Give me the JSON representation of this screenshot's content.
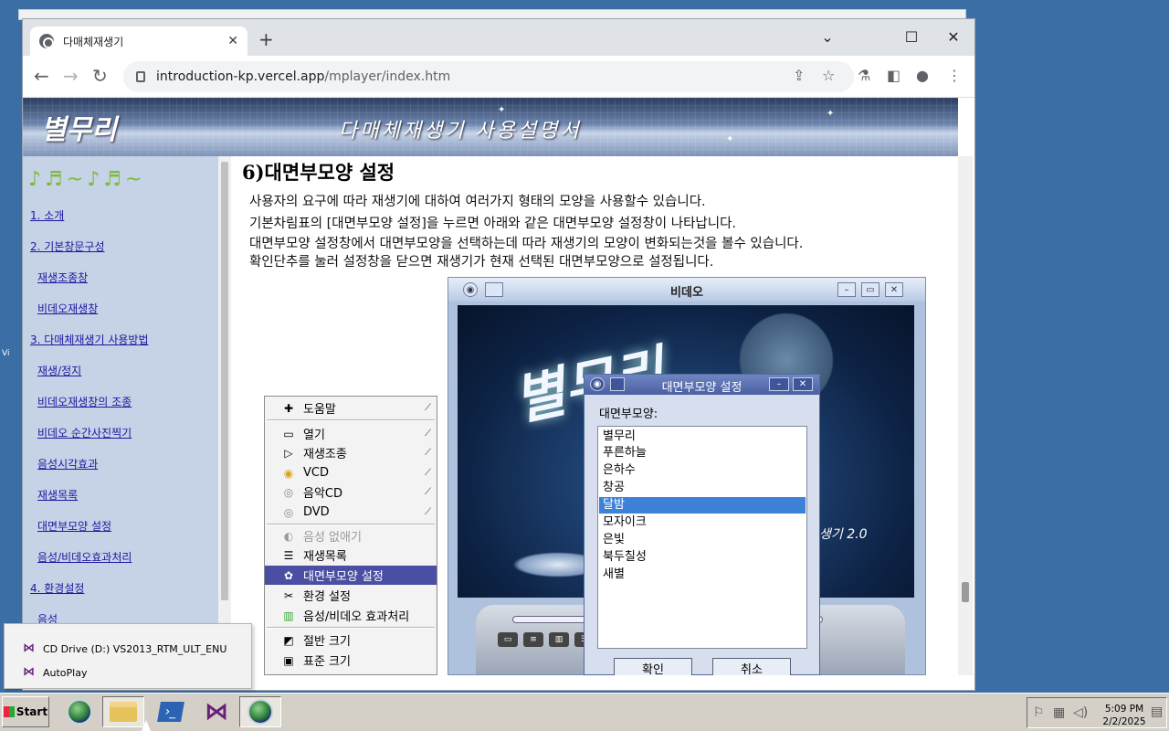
{
  "browser": {
    "tab_title": "다매체재생기",
    "tab_close": "✕",
    "new_tab": "+",
    "url_host": "introduction-kp.vercel.app",
    "url_path": "/mplayer/index.htm",
    "controls": {
      "minimize": "⌄",
      "restore": "☐",
      "close": "✕",
      "back": "←",
      "forward": "→",
      "reload": "↻",
      "share": "⇪",
      "bookmark": "☆",
      "extensions": "⚗",
      "sidepanel": "◧",
      "profile": "●",
      "menu": "⋮"
    }
  },
  "banner": {
    "logo": "별무리",
    "title": "다매체재생기 사용설명서"
  },
  "sidebar": {
    "deco": "♪♬~♪♬~",
    "items": [
      {
        "label": "1. 소개"
      },
      {
        "label": "2. 기본창문구성"
      },
      {
        "label": "재생조종창"
      },
      {
        "label": "비데오재생창"
      },
      {
        "label": "3. 다매체재생기 사용방법"
      },
      {
        "label": "재생/정지"
      },
      {
        "label": "비데오재생창의 조종"
      },
      {
        "label": "비데오 순간사진찍기"
      },
      {
        "label": "음성시각효과"
      },
      {
        "label": "재생목록"
      },
      {
        "label": "대면부모양 설정"
      },
      {
        "label": "음성/비데오효과처리"
      },
      {
        "label": "4. 환경설정"
      },
      {
        "label": "음성"
      }
    ]
  },
  "content": {
    "heading": "6)대면부모양 설정",
    "paragraphs": [
      "사용자의 요구에 따라 재생기에 대하여 여러가지 형태의 모양을 사용할수 있습니다.",
      "기본차림표의 [대면부모양 설정]을 누르면 아래와 같은 대면부모양 설정창이 나타납니다.",
      "대면부모양 설정창에서 대면부모양을 선택하는데 따라 재생기의 모양이 변화되는것을 볼수 있습니다.",
      "확인단추를 눌러 설정창을 닫으면 재생기가 현재 선택된 대면부모양으로 설정됩니다."
    ]
  },
  "context_menu": {
    "items": [
      {
        "label": "도움말",
        "icon": "help-book-icon",
        "glyph": "✚",
        "arrow": "⟋"
      },
      {
        "label": "열기",
        "icon": "folder-icon",
        "glyph": "▭",
        "arrow": "⟋"
      },
      {
        "label": "재생조종",
        "icon": "play-icon",
        "glyph": "▷",
        "arrow": "⟋"
      },
      {
        "label": "VCD",
        "icon": "vcd-disc-icon",
        "glyph": "◉",
        "arrow": "⟋"
      },
      {
        "label": "음악CD",
        "icon": "cd-disc-icon",
        "glyph": "◎",
        "arrow": "⟋"
      },
      {
        "label": "DVD",
        "icon": "dvd-disc-icon",
        "glyph": "◎",
        "arrow": "⟋"
      },
      {
        "label": "음성 없애기",
        "icon": "mute-icon",
        "glyph": "◐",
        "arrow": ""
      },
      {
        "label": "재생목록",
        "icon": "list-icon",
        "glyph": "☰",
        "arrow": ""
      },
      {
        "label": "대면부모양 설정",
        "icon": "palette-icon",
        "glyph": "✿",
        "arrow": ""
      },
      {
        "label": "환경 설정",
        "icon": "tools-icon",
        "glyph": "✂",
        "arrow": ""
      },
      {
        "label": "음성/비데오 효과처리",
        "icon": "equalizer-icon",
        "glyph": "▥",
        "arrow": ""
      },
      {
        "label": "절반 크기",
        "icon": "half-size-icon",
        "glyph": "◩",
        "arrow": ""
      },
      {
        "label": "표준 크기",
        "icon": "normal-size-icon",
        "glyph": "▣",
        "arrow": ""
      }
    ]
  },
  "video_window": {
    "title": "비데오",
    "version_text": "생기 2.0",
    "logo": "별무리"
  },
  "dialog": {
    "title": "대면부모양 설정",
    "label": "대면부모양:",
    "options": [
      "별무리",
      "푸른하늘",
      "은하수",
      "창공",
      "달밤",
      "모자이크",
      "은빛",
      "북두칠성",
      "새별"
    ],
    "selected": "달밤",
    "ok": "확인",
    "cancel": "취소"
  },
  "autoplay": {
    "items": [
      "CD Drive (D:) VS2013_RTM_ULT_ENU",
      "AutoPlay"
    ]
  },
  "taskbar": {
    "start": "Start",
    "time": "5:09 PM",
    "date": "2/2/2025"
  },
  "colors": {
    "desktop": "#3a6ea5",
    "menu_selected": "#4b4fa3",
    "list_selected": "#3d82d8",
    "link": "#1a1aa0"
  }
}
